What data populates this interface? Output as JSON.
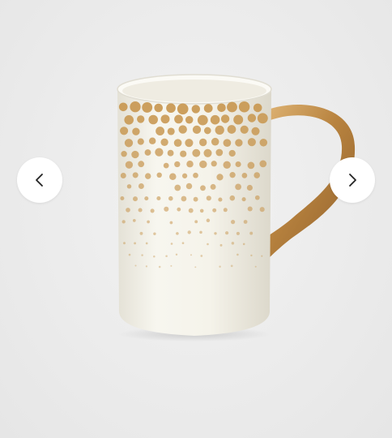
{
  "gallery": {
    "prev": {
      "icon": "chevron-left-icon"
    },
    "next": {
      "icon": "chevron-right-icon"
    }
  },
  "colors": {
    "background": "#ececec",
    "mug_body": "#f5f3ea",
    "gold": "#c99a55",
    "nav_button": "#ffffff",
    "chevron": "#222222"
  }
}
